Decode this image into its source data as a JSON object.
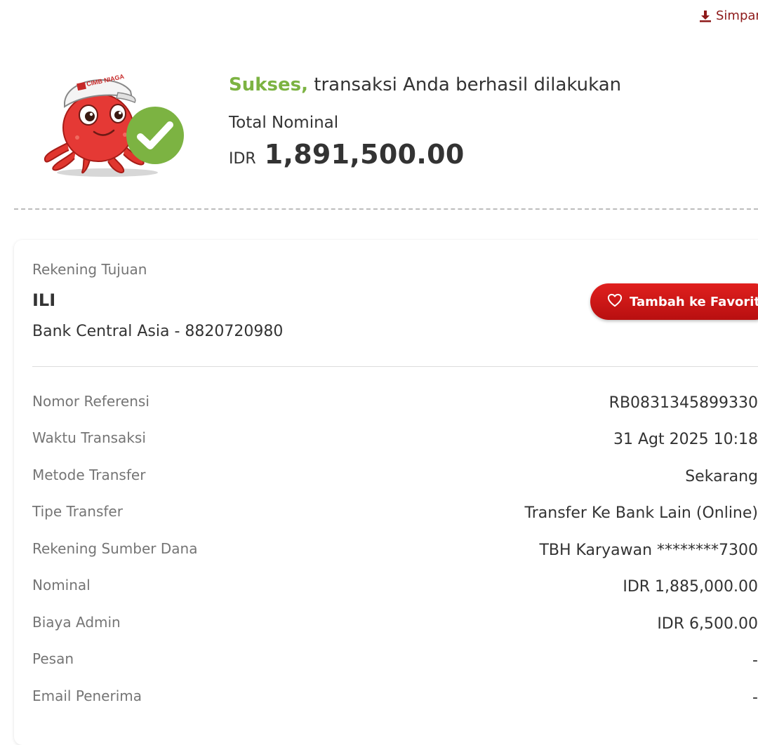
{
  "header": {
    "save_label": "Simpan",
    "save_icon": "download-icon",
    "accent_color": "#8e1a1a"
  },
  "mascot": {
    "cap_text": "CIMB NIAGA",
    "icon": "octopus-mascot",
    "check_icon": "check-circle-icon",
    "check_color": "#7cb342"
  },
  "result": {
    "status_word": "Sukses,",
    "status_text": " transaksi Anda berhasil dilakukan",
    "status_color": "#7cb342",
    "total_label": "Total Nominal",
    "total_currency": "IDR",
    "total_amount": "1,891,500.00"
  },
  "destination": {
    "label": "Rekening Tujuan",
    "name": "ILI",
    "bank": "Bank Central Asia - 8820720980"
  },
  "favorite_button": {
    "label": "Tambah ke Favorit",
    "icon": "heart-icon",
    "color": "#c8161d"
  },
  "details": [
    {
      "label": "Nomor Referensi",
      "value": "RB0831345899330"
    },
    {
      "label": "Waktu Transaksi",
      "value": "31 Agt 2025 10:18"
    },
    {
      "label": "Metode Transfer",
      "value": "Sekarang"
    },
    {
      "label": "Tipe Transfer",
      "value": "Transfer Ke Bank Lain (Online)"
    },
    {
      "label": "Rekening Sumber Dana",
      "value": "TBH Karyawan ********7300"
    },
    {
      "label": "Nominal",
      "value": "IDR 1,885,000.00"
    },
    {
      "label": "Biaya Admin",
      "value": "IDR 6,500.00"
    },
    {
      "label": "Pesan",
      "value": "-"
    },
    {
      "label": "Email Penerima",
      "value": "-"
    }
  ]
}
